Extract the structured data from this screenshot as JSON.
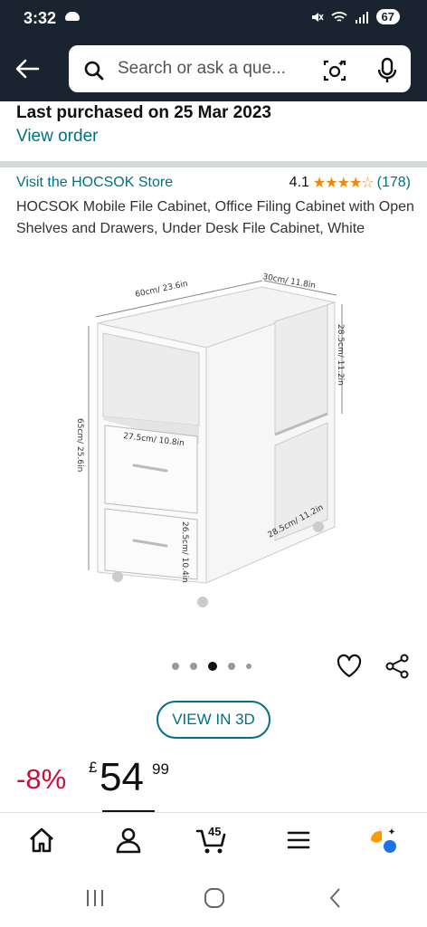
{
  "status_bar": {
    "time": "3:32",
    "battery": "67"
  },
  "header": {
    "search_placeholder": "Search or ask a que..."
  },
  "purchase": {
    "title": "Last purchased on 25 Mar 2023",
    "link": "View order"
  },
  "product": {
    "store_link": "Visit the HOCSOK Store",
    "rating": "4.1",
    "rating_stars": "★★★★☆",
    "rating_count": "(178)",
    "title": "HOCSOK Mobile File Cabinet, Office Filing Cabinet with Open Shelves and Drawers, Under Desk File Cabinet, White",
    "image_dimensions": {
      "width": "60cm/ 23.6in",
      "depth": "30cm/ 11.8in",
      "height": "65cm/ 25.6in",
      "shelf_height": "28.5cm/ 11.2in",
      "drawer_width": "27.5cm/ 10.8in",
      "drawer_height": "26.5cm/ 10.4in",
      "inner_depth": "28.5cm/ 11.2in"
    },
    "carousel": {
      "count": 5,
      "active_index": 2
    },
    "view_3d": "VIEW IN 3D"
  },
  "price": {
    "discount": "-8%",
    "currency": "£",
    "whole": "54",
    "fraction": "99"
  },
  "bottom_nav": {
    "items": [
      "home-icon",
      "account-icon",
      "cart-icon",
      "menu-icon",
      "rufus-icon"
    ],
    "cart_count": "45",
    "active_index": 1
  },
  "colors": {
    "link": "#007185",
    "discount": "#cc0c39",
    "header": "#1a2430",
    "star": "#f08804"
  }
}
